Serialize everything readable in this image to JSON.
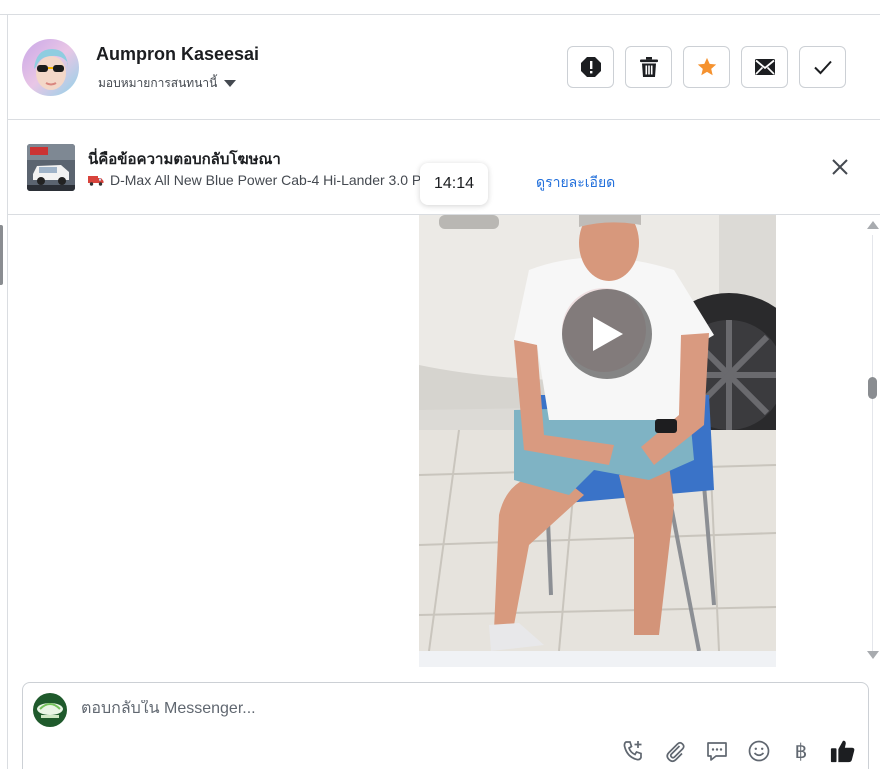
{
  "conversation": {
    "contact_name": "Aumpron Kaseesai",
    "assign_label": "มอบหมายการสนทนานี้",
    "actions": [
      {
        "name": "spam-button",
        "icon": "alert-icon"
      },
      {
        "name": "delete-button",
        "icon": "trash-icon"
      },
      {
        "name": "star-button",
        "icon": "star-icon"
      },
      {
        "name": "mark-unread-button",
        "icon": "envelope-icon"
      },
      {
        "name": "mark-done-button",
        "icon": "check-icon"
      }
    ]
  },
  "ad_reply": {
    "title": "นี่คือข้อความตอบกลับโฆษณา",
    "ad_name": "D-Max All New Blue Power Cab-4 Hi-Lander 3.0 Prestig...",
    "details_link": "ดูรายละเอียด",
    "ad_icon": "truck-emoji"
  },
  "timestamp": "14:14",
  "message": {
    "type": "video",
    "play_icon": "play-icon"
  },
  "composer": {
    "placeholder": "ตอบกลับใน Messenger...",
    "tools": [
      "phone-plus-icon",
      "paperclip-icon",
      "saved-reply-icon",
      "emoji-icon",
      "baht-icon",
      "like-icon"
    ],
    "baht_symbol": "฿"
  },
  "colors": {
    "accent": "#216fdb",
    "star": "#f5922f",
    "border": "#ccd0d5"
  }
}
